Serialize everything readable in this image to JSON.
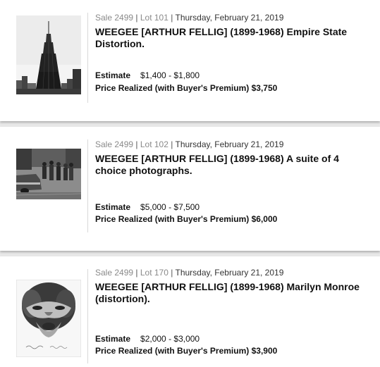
{
  "lots": [
    {
      "sale_label": "Sale 2499",
      "lot_label": "Lot 101",
      "date": "Thursday, February 21, 2019",
      "title": "WEEGEE [ARTHUR FELLIG] (1899-1968) Empire State Distortion.",
      "estimate_label": "Estimate",
      "estimate_value": "$1,400 - $1,800",
      "price_label": "Price Realized (with Buyer's Premium)",
      "price_value": "$3,750",
      "image": "empire-state-photo"
    },
    {
      "sale_label": "Sale 2499",
      "lot_label": "Lot 102",
      "date": "Thursday, February 21, 2019",
      "title": "WEEGEE [ARTHUR FELLIG] (1899-1968) A suite of 4 choice photographs.",
      "estimate_label": "Estimate",
      "estimate_value": "$5,000 - $7,500",
      "price_label": "Price Realized (with Buyer's Premium)",
      "price_value": "$6,000",
      "image": "street-scene-photo"
    },
    {
      "sale_label": "Sale 2499",
      "lot_label": "Lot 170",
      "date": "Thursday, February 21, 2019",
      "title": "WEEGEE [ARTHUR FELLIG] (1899-1968) Marilyn Monroe (distortion).",
      "estimate_label": "Estimate",
      "estimate_value": "$2,000 - $3,000",
      "price_label": "Price Realized (with Buyer's Premium)",
      "price_value": "$3,900",
      "image": "marilyn-monroe-photo"
    }
  ]
}
